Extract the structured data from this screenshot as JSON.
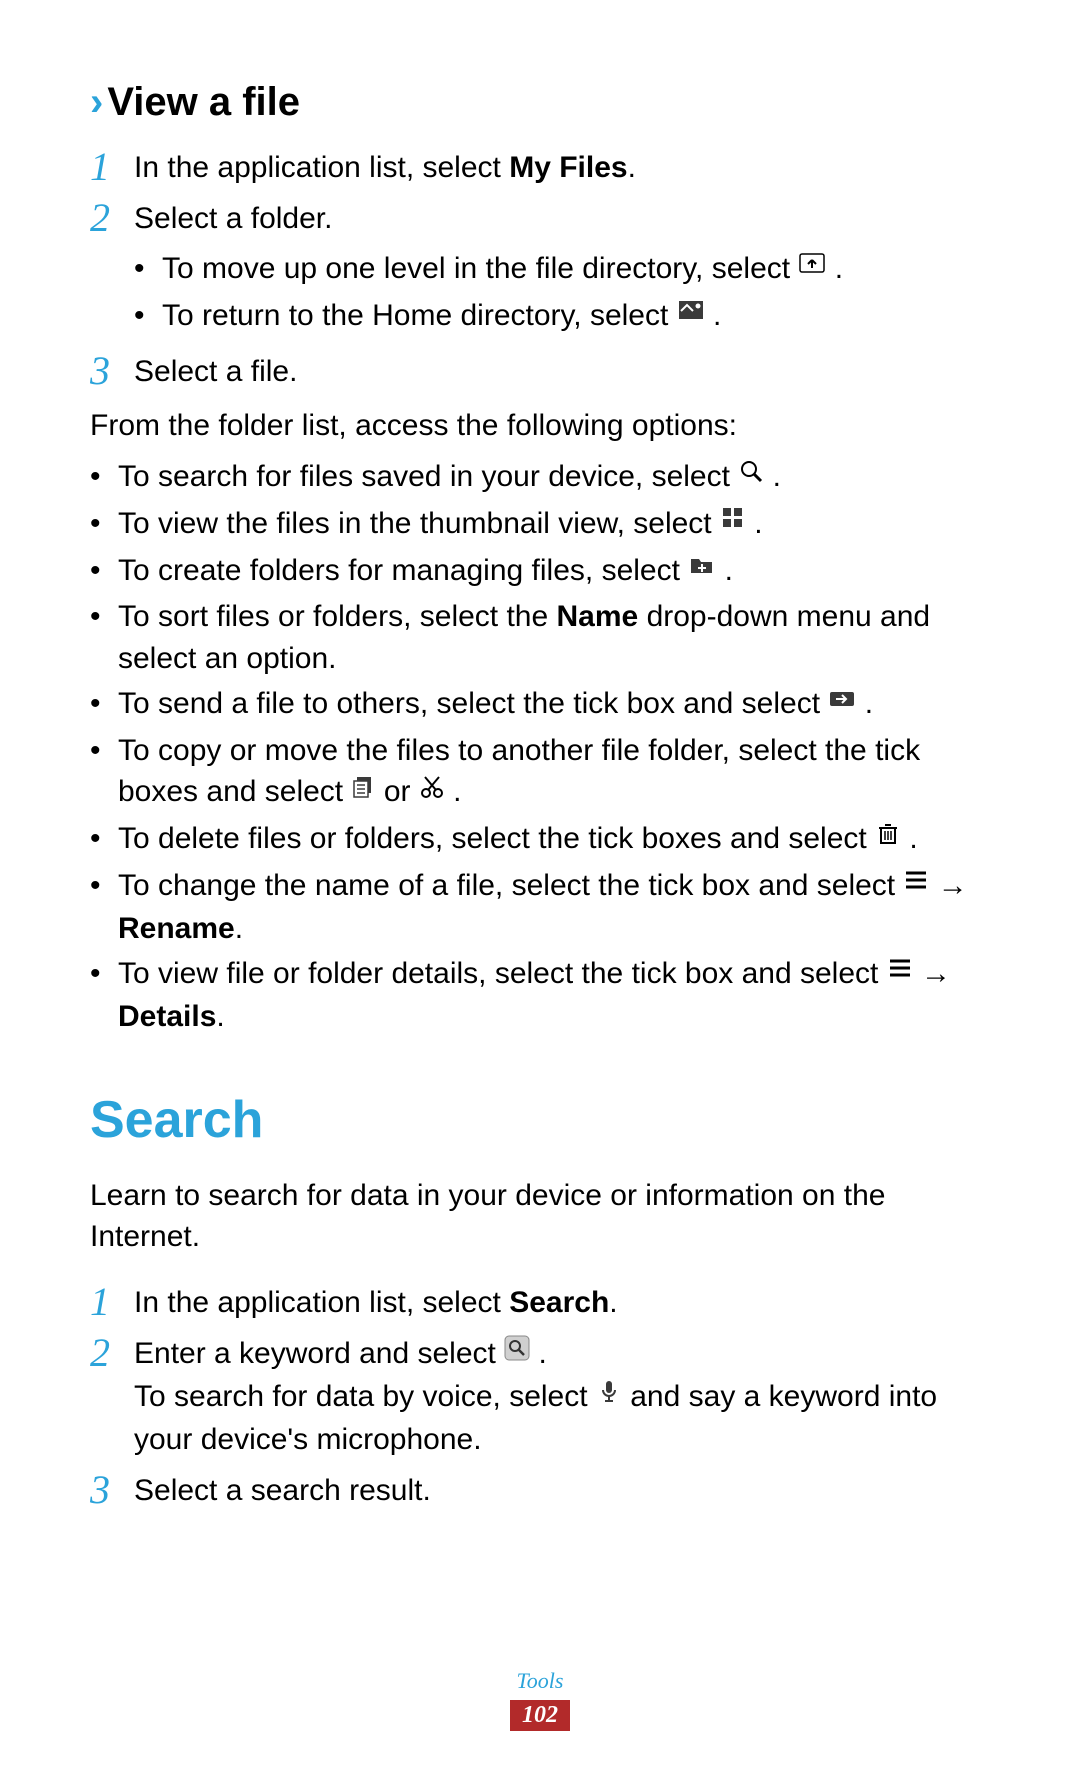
{
  "section1": {
    "chevron": "›",
    "title": "View a file",
    "step1": {
      "num": "1",
      "pre": "In the application list, select ",
      "bold": "My Files",
      "post": "."
    },
    "step2": {
      "num": "2",
      "text": "Select a folder.",
      "sub1": {
        "dot": "•",
        "pre": "To move up one level in the file directory, select ",
        "post": " ."
      },
      "sub2": {
        "dot": "•",
        "pre": "To return to the Home directory, select ",
        "post": " ."
      }
    },
    "step3": {
      "num": "3",
      "text": "Select a file."
    },
    "options_intro": "From the folder list, access the following options:",
    "b1": {
      "dot": "•",
      "pre": "To search for files saved in your device, select ",
      "post": " ."
    },
    "b2": {
      "dot": "•",
      "pre": "To view the files in the thumbnail view, select ",
      "post": " ."
    },
    "b3": {
      "dot": "•",
      "pre": "To create folders for managing files, select ",
      "post": " ."
    },
    "b4": {
      "dot": "•",
      "pre": "To sort files or folders, select the ",
      "bold": "Name",
      "post": " drop-down menu and select an option."
    },
    "b5": {
      "dot": "•",
      "pre": "To send a file to others, select the tick box and select ",
      "post": " ."
    },
    "b6": {
      "dot": "•",
      "pre": "To copy or move the files to another file folder, select the tick boxes and select ",
      "mid": " or ",
      "post": " ."
    },
    "b7": {
      "dot": "•",
      "pre": "To delete files or folders, select the tick boxes and select ",
      "post": " ."
    },
    "b8": {
      "dot": "•",
      "pre": "To change the name of a file, select the tick box and select ",
      "arrow": " → ",
      "bold": "Rename",
      "post": "."
    },
    "b9": {
      "dot": "•",
      "pre": "To view file or folder details, select the tick box and select ",
      "arrow": " → ",
      "bold": "Details",
      "post": "."
    }
  },
  "section2": {
    "title": "Search",
    "intro": "Learn to search for data in your device or information on the Internet.",
    "step1": {
      "num": "1",
      "pre": "In the application list, select ",
      "bold": "Search",
      "post": "."
    },
    "step2": {
      "num": "2",
      "line1_pre": "Enter a keyword and select ",
      "line1_post": " .",
      "line2_pre": "To search for data by voice, select ",
      "line2_post": " and say a keyword into your device's microphone."
    },
    "step3": {
      "num": "3",
      "text": "Select a search result."
    }
  },
  "footer": {
    "label": "Tools",
    "page": "102"
  }
}
